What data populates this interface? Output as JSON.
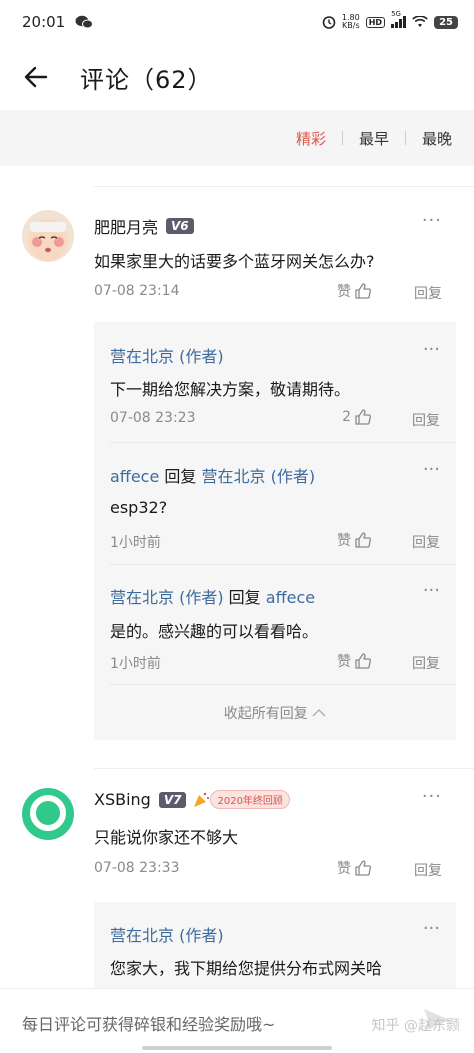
{
  "statusbar": {
    "time": "20:01",
    "speed_top": "1.80",
    "speed_bottom": "KB/s",
    "hd": "HD",
    "net": "5G",
    "battery": "25"
  },
  "header": {
    "title": "评论（62）"
  },
  "sort": {
    "options": [
      "精彩",
      "最早",
      "最晚"
    ],
    "active": 0
  },
  "comments": [
    {
      "user": "肥肥月亮",
      "level": "V6",
      "text": "如果家里大的话要多个蓝牙网关怎么办?",
      "time": "07-08 23:14",
      "like": "赞",
      "reply": "回复",
      "more": "···",
      "replies": [
        {
          "user": "营在北京 (作者)",
          "reply_word": "",
          "to": "",
          "text": "下一期给您解决方案，敬请期待。",
          "time": "07-08 23:23",
          "like": "2",
          "reply": "回复",
          "more": "···"
        },
        {
          "user": "affece",
          "reply_word": "回复",
          "to": "营在北京 (作者)",
          "text": "esp32?",
          "time": "1小时前",
          "like": "赞",
          "reply": "回复",
          "more": "···"
        },
        {
          "user": "营在北京 (作者)",
          "reply_word": "回复",
          "to": "affece",
          "text": "是的。感兴趣的可以看看哈。",
          "time": "1小时前",
          "like": "赞",
          "reply": "回复",
          "more": "···"
        }
      ],
      "collapse": "收起所有回复"
    },
    {
      "user": "XSBing",
      "level": "V7",
      "badge": "2020年终回顾",
      "text": "只能说你家还不够大",
      "time": "07-08 23:33",
      "like": "赞",
      "reply": "回复",
      "more": "···",
      "replies": [
        {
          "user": "营在北京 (作者)",
          "text": "您家大，我下期给您提供分布式网关哈",
          "more": "···"
        }
      ]
    }
  ],
  "bottom": {
    "placeholder": "每日评论可获得碎银和经验奖励哦~",
    "watermark": "知乎 @赵东颢"
  },
  "colors": {
    "accent": "#e0584d",
    "author_blue": "#3d6b9e",
    "sortbar_bg": "#f5f5f5",
    "reply_bg": "#f6f6f6"
  },
  "icons": [
    "back-arrow-icon",
    "more-dots-icon",
    "thumb-up-icon",
    "chevron-up-icon",
    "send-icon",
    "wechat-icon"
  ]
}
